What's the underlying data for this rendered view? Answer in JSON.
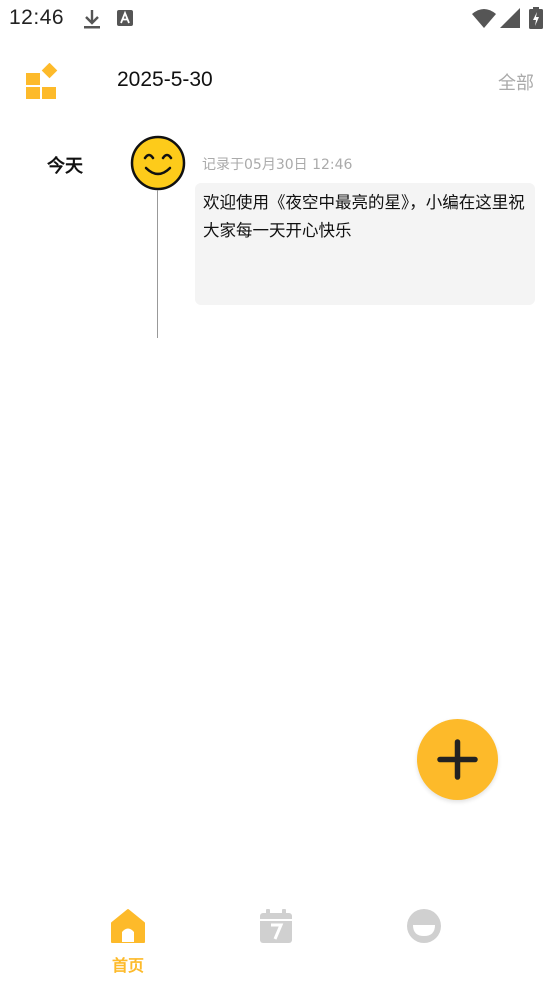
{
  "status_bar": {
    "time": "12:46",
    "icons": [
      "download-icon",
      "a-icon",
      "wifi-icon",
      "signal-icon",
      "battery-icon"
    ]
  },
  "header": {
    "date": "2025-5-30",
    "all_label": "全部"
  },
  "entries": [
    {
      "day_label": "今天",
      "mood_icon": "smiley-face-icon",
      "record_time": "记录于05月30日 12:46",
      "text": "欢迎使用《夜空中最亮的星》，小编在这里祝大家每一天开心快乐"
    }
  ],
  "fab": {
    "icon": "plus-icon"
  },
  "bottom_nav": {
    "items": [
      {
        "label": "首页",
        "icon": "home-icon",
        "active": true
      },
      {
        "label": "",
        "icon": "calendar-icon",
        "active": false
      },
      {
        "label": "",
        "icon": "profile-icon",
        "active": false
      }
    ]
  },
  "colors": {
    "accent": "#FDBA2A",
    "inactive": "#D0D0D0",
    "card_bg": "#F4F4F4",
    "muted_text": "#AAAAAA"
  }
}
